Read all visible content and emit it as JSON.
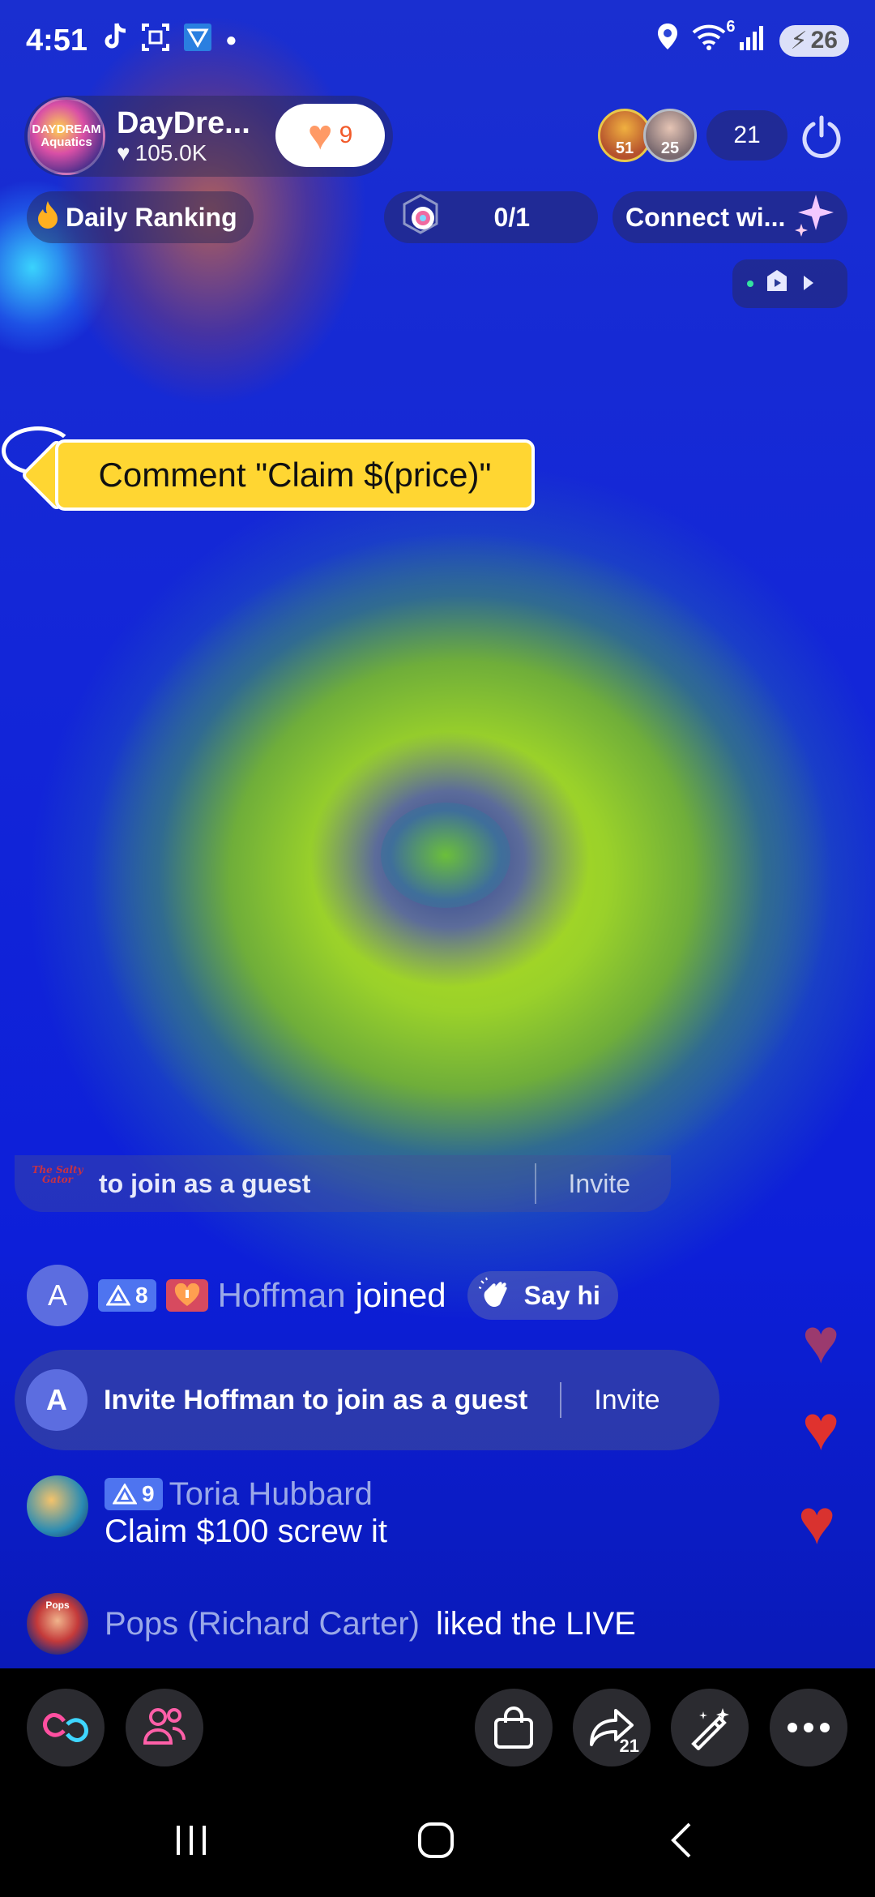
{
  "status_bar": {
    "time": "4:51",
    "wifi_sup": "6",
    "battery": "26",
    "icons": [
      "tiktok-icon",
      "screen-capture-icon",
      "vpn-icon",
      "dot-icon",
      "location-icon",
      "wifi-icon",
      "signal-icon",
      "battery-icon"
    ]
  },
  "host": {
    "name": "DayDre...",
    "likes": "105.0K",
    "avatar_text": "DAYDREAM Aquatics",
    "heart_count": "9"
  },
  "viewers": {
    "avatars": [
      {
        "label": "51"
      },
      {
        "label": "25"
      }
    ],
    "count": "21"
  },
  "pills": {
    "daily_ranking": "Daily Ranking",
    "goal": "0/1",
    "connect": "Connect wi..."
  },
  "claim_tag": {
    "text": "Comment \"Claim $(price)\""
  },
  "chat": {
    "faded": {
      "avatar_text": "The Salty Gator",
      "text": "to join as a guest",
      "action": "Invite"
    },
    "joined": {
      "avatar_letter": "A",
      "level": "8",
      "user": "Hoffman",
      "verb": "joined",
      "say_hi": "Say hi"
    },
    "invite": {
      "avatar_letter": "A",
      "text": "Invite Hoffman to join as a guest",
      "action": "Invite"
    },
    "comment": {
      "level": "9",
      "user": "Toria Hubbard",
      "message": "Claim $100 screw it"
    },
    "liked": {
      "avatar_text": "Pops",
      "user": "Pops (Richard Carter)",
      "text": "liked the LIVE"
    }
  },
  "toolbar": {
    "share_count": "21",
    "buttons": [
      "link-icon",
      "guests-icon",
      "shopping-bag-icon",
      "share-icon",
      "magic-wand-icon",
      "more-icon"
    ]
  },
  "colors": {
    "accent_yellow": "#ffd632",
    "muted_name": "#9aa8e8",
    "level_badge": "#4e74f0",
    "fan_badge": "#d74a5f",
    "heart_orange": "#ff9a66"
  }
}
